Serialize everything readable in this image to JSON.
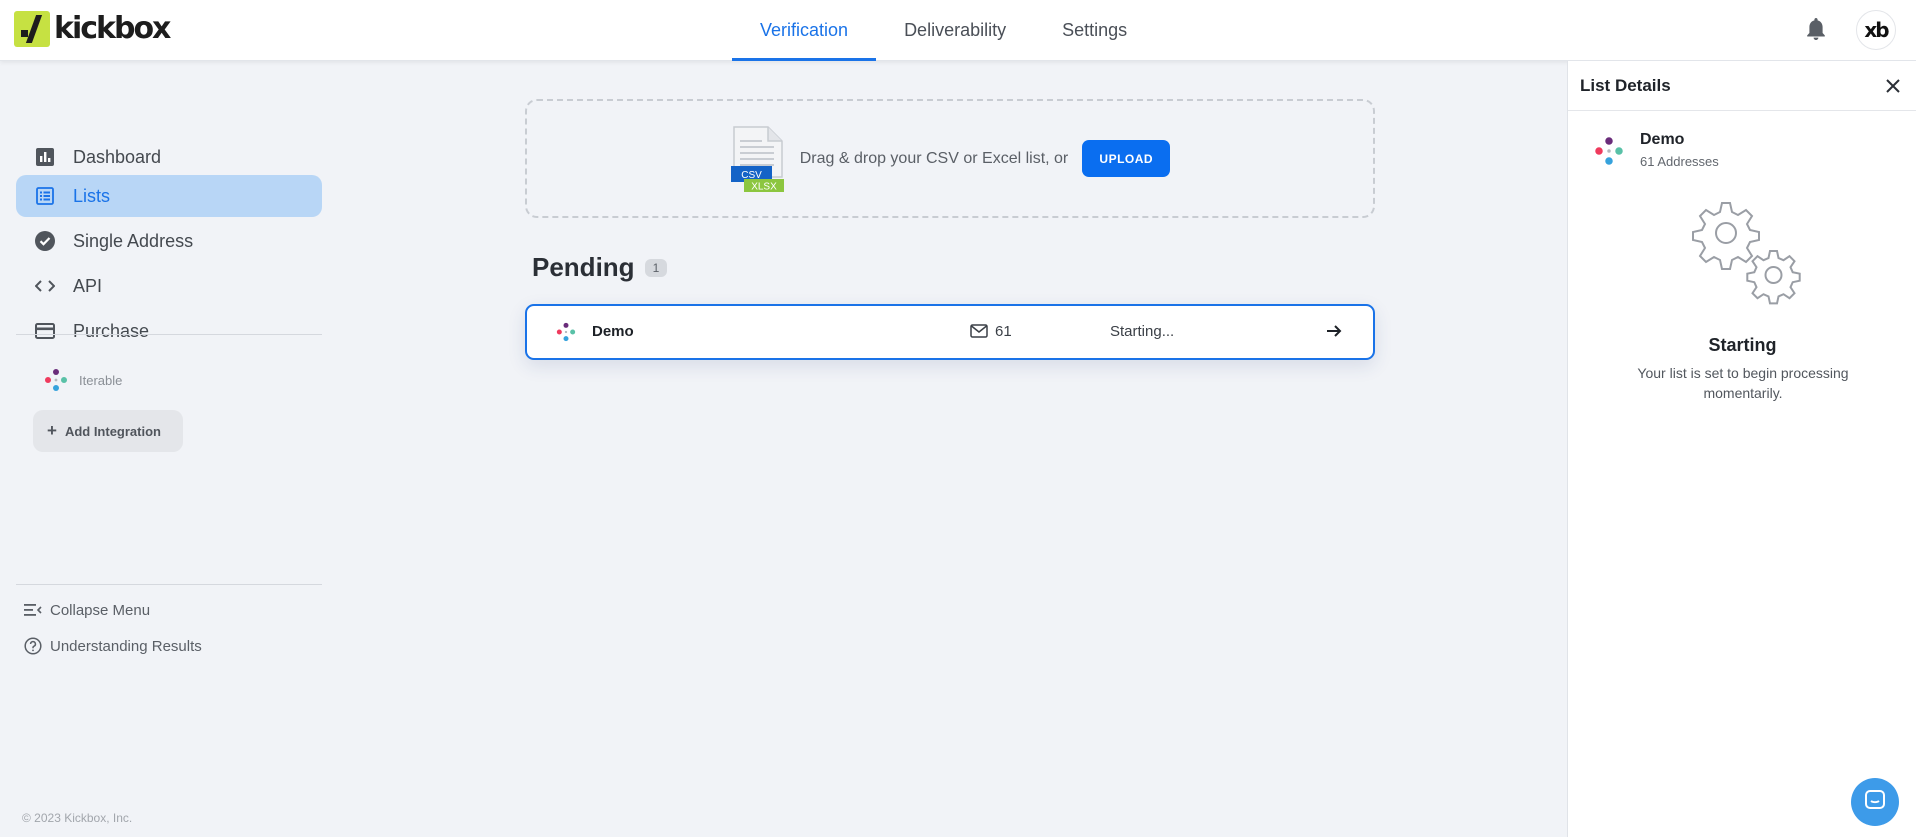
{
  "brand": {
    "logo_text": "kickbox",
    "accent": "#1a73e8",
    "logo_color": "#c6e142"
  },
  "topnav": {
    "tabs": [
      {
        "label": "Verification",
        "active": true
      },
      {
        "label": "Deliverability",
        "active": false
      },
      {
        "label": "Settings",
        "active": false
      }
    ],
    "notifications_icon": "bell-icon",
    "avatar_text": "xb"
  },
  "sidebar": {
    "items": [
      {
        "label": "Dashboard",
        "icon": "bar-chart-icon",
        "active": false
      },
      {
        "label": "Lists",
        "icon": "list-icon",
        "active": true
      },
      {
        "label": "Single Address",
        "icon": "check-circle-icon",
        "active": false
      },
      {
        "label": "API",
        "icon": "code-icon",
        "active": false
      },
      {
        "label": "Purchase",
        "icon": "credit-card-icon",
        "active": false
      }
    ],
    "integration": {
      "label": "Iterable",
      "icon": "iterable-logo-icon"
    },
    "add_integration_label": "Add Integration",
    "collapse_label": "Collapse Menu",
    "help_label": "Understanding Results",
    "copyright": "© 2023 Kickbox, Inc."
  },
  "upload": {
    "file_badges": [
      "CSV",
      "XLSX"
    ],
    "text": "Drag & drop your CSV or Excel list, or",
    "button_label": "UPLOAD"
  },
  "pending": {
    "title": "Pending",
    "count": "1",
    "lists": [
      {
        "name": "Demo",
        "count": "61",
        "status": "Starting..."
      }
    ]
  },
  "details_panel": {
    "title": "List Details",
    "list_name": "Demo",
    "list_sub": "61 Addresses",
    "state_title": "Starting",
    "state_desc": "Your list is set to begin processing momentarily."
  }
}
